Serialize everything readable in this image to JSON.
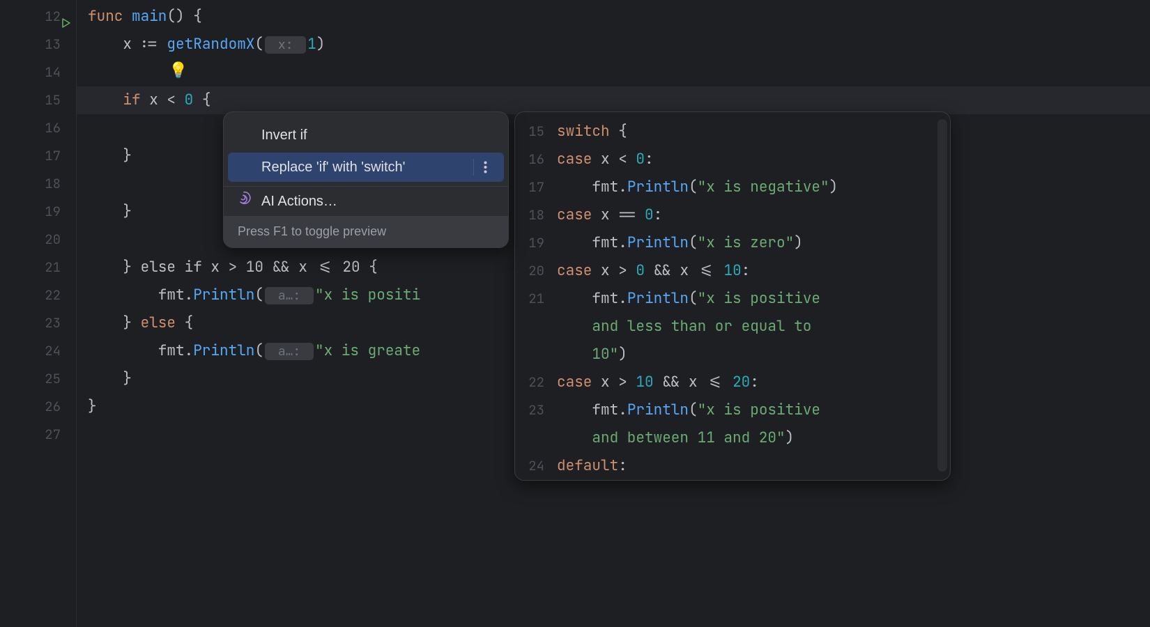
{
  "editor": {
    "lines": [
      {
        "n": "12",
        "run": true,
        "tokens": [
          [
            "kw",
            "func "
          ],
          [
            "fn",
            "main"
          ],
          [
            "paren",
            "() {"
          ]
        ]
      },
      {
        "n": "13",
        "tokens": [
          [
            "",
            "    x "
          ],
          [
            "paren",
            ":= "
          ],
          [
            "fn",
            "getRandomX"
          ],
          [
            "paren",
            "("
          ],
          [
            "hint",
            " x: "
          ],
          [
            "num-lit",
            "1"
          ],
          [
            "paren",
            ")"
          ]
        ]
      },
      {
        "n": "14",
        "tokens": []
      },
      {
        "n": "15",
        "hl": true,
        "tokens": [
          [
            "",
            "    "
          ],
          [
            "kw",
            "if"
          ],
          [
            "",
            " x "
          ],
          [
            "paren",
            "< "
          ],
          [
            "num-lit",
            "0"
          ],
          [
            "",
            " "
          ],
          [
            "paren",
            "{"
          ]
        ]
      },
      {
        "n": "16",
        "tokens": []
      },
      {
        "n": "17",
        "tokens": [
          [
            "",
            "    "
          ],
          [
            "paren",
            "}"
          ]
        ]
      },
      {
        "n": "18",
        "tokens": []
      },
      {
        "n": "19",
        "tokens": [
          [
            "",
            "    "
          ],
          [
            "paren",
            "}"
          ]
        ]
      },
      {
        "n": "20",
        "tokens": []
      },
      {
        "n": "21",
        "tokens": [
          [
            "",
            "    "
          ],
          [
            "paren",
            "} "
          ],
          [
            "",
            "else if x > 10 && x <= 20 {"
          ]
        ]
      },
      {
        "n": "22",
        "tokens": [
          [
            "",
            "        fmt."
          ],
          [
            "fn",
            "Println"
          ],
          [
            "paren",
            "("
          ],
          [
            "hint",
            " a…: "
          ],
          [
            "str",
            "\"x is positi"
          ]
        ]
      },
      {
        "n": "23",
        "tokens": [
          [
            "",
            "    "
          ],
          [
            "paren",
            "} "
          ],
          [
            "kw",
            "else"
          ],
          [
            "",
            " "
          ],
          [
            "paren",
            "{"
          ]
        ]
      },
      {
        "n": "24",
        "tokens": [
          [
            "",
            "        fmt."
          ],
          [
            "fn",
            "Println"
          ],
          [
            "paren",
            "("
          ],
          [
            "hint",
            " a…: "
          ],
          [
            "str",
            "\"x is greate"
          ]
        ]
      },
      {
        "n": "25",
        "tokens": [
          [
            "",
            "    "
          ],
          [
            "paren",
            "}"
          ]
        ]
      },
      {
        "n": "26",
        "tokens": [
          [
            "paren",
            "}"
          ]
        ]
      },
      {
        "n": "27",
        "tokens": []
      }
    ]
  },
  "popup": {
    "items": [
      {
        "label": "Invert if",
        "selected": false
      },
      {
        "label": "Replace 'if' with 'switch'",
        "selected": true,
        "more": true
      }
    ],
    "ai_label": "AI Actions…",
    "hint": "Press F1 to toggle preview"
  },
  "preview": {
    "lines": [
      {
        "n": "15",
        "tokens": [
          [
            "kw",
            "switch"
          ],
          [
            "",
            " "
          ],
          [
            "paren",
            "{"
          ]
        ]
      },
      {
        "n": "16",
        "tokens": [
          [
            "kw",
            "case"
          ],
          [
            "",
            " x "
          ],
          [
            "paren",
            "< "
          ],
          [
            "num-lit",
            "0"
          ],
          [
            "paren",
            ":"
          ]
        ]
      },
      {
        "n": "17",
        "tokens": [
          [
            "",
            "    fmt."
          ],
          [
            "fn",
            "Println"
          ],
          [
            "paren",
            "("
          ],
          [
            "str",
            "\"x is negative\""
          ],
          [
            "paren",
            ")"
          ]
        ]
      },
      {
        "n": "18",
        "tokens": [
          [
            "kw",
            "case"
          ],
          [
            "",
            " x "
          ],
          [
            "paren",
            "== "
          ],
          [
            "num-lit",
            "0"
          ],
          [
            "paren",
            ":"
          ]
        ]
      },
      {
        "n": "19",
        "tokens": [
          [
            "",
            "    fmt."
          ],
          [
            "fn",
            "Println"
          ],
          [
            "paren",
            "("
          ],
          [
            "str",
            "\"x is zero\""
          ],
          [
            "paren",
            ")"
          ]
        ]
      },
      {
        "n": "20",
        "tokens": [
          [
            "kw",
            "case"
          ],
          [
            "",
            " x "
          ],
          [
            "paren",
            "> "
          ],
          [
            "num-lit",
            "0"
          ],
          [
            "",
            " "
          ],
          [
            "paren",
            "&&"
          ],
          [
            "",
            " x "
          ],
          [
            "paren",
            "<= "
          ],
          [
            "num-lit",
            "10"
          ],
          [
            "paren",
            ":"
          ]
        ]
      },
      {
        "n": "21",
        "tokens": [
          [
            "",
            "    fmt."
          ],
          [
            "fn",
            "Println"
          ],
          [
            "paren",
            "("
          ],
          [
            "str",
            "\"x is positive"
          ]
        ]
      },
      {
        "n": "",
        "tokens": [
          [
            "str",
            "    and less than or equal to"
          ]
        ]
      },
      {
        "n": "",
        "tokens": [
          [
            "str",
            "    10\""
          ],
          [
            "paren",
            ")"
          ]
        ]
      },
      {
        "n": "22",
        "tokens": [
          [
            "kw",
            "case"
          ],
          [
            "",
            " x "
          ],
          [
            "paren",
            "> "
          ],
          [
            "num-lit",
            "10"
          ],
          [
            "",
            " "
          ],
          [
            "paren",
            "&&"
          ],
          [
            "",
            " x "
          ],
          [
            "paren",
            "<= "
          ],
          [
            "num-lit",
            "20"
          ],
          [
            "paren",
            ":"
          ]
        ]
      },
      {
        "n": "23",
        "tokens": [
          [
            "",
            "    fmt."
          ],
          [
            "fn",
            "Println"
          ],
          [
            "paren",
            "("
          ],
          [
            "str",
            "\"x is positive"
          ]
        ]
      },
      {
        "n": "",
        "tokens": [
          [
            "str",
            "    and between 11 and 20\""
          ],
          [
            "paren",
            ")"
          ]
        ]
      },
      {
        "n": "24",
        "tokens": [
          [
            "kw",
            "default"
          ],
          [
            "paren",
            ":"
          ]
        ]
      }
    ]
  }
}
